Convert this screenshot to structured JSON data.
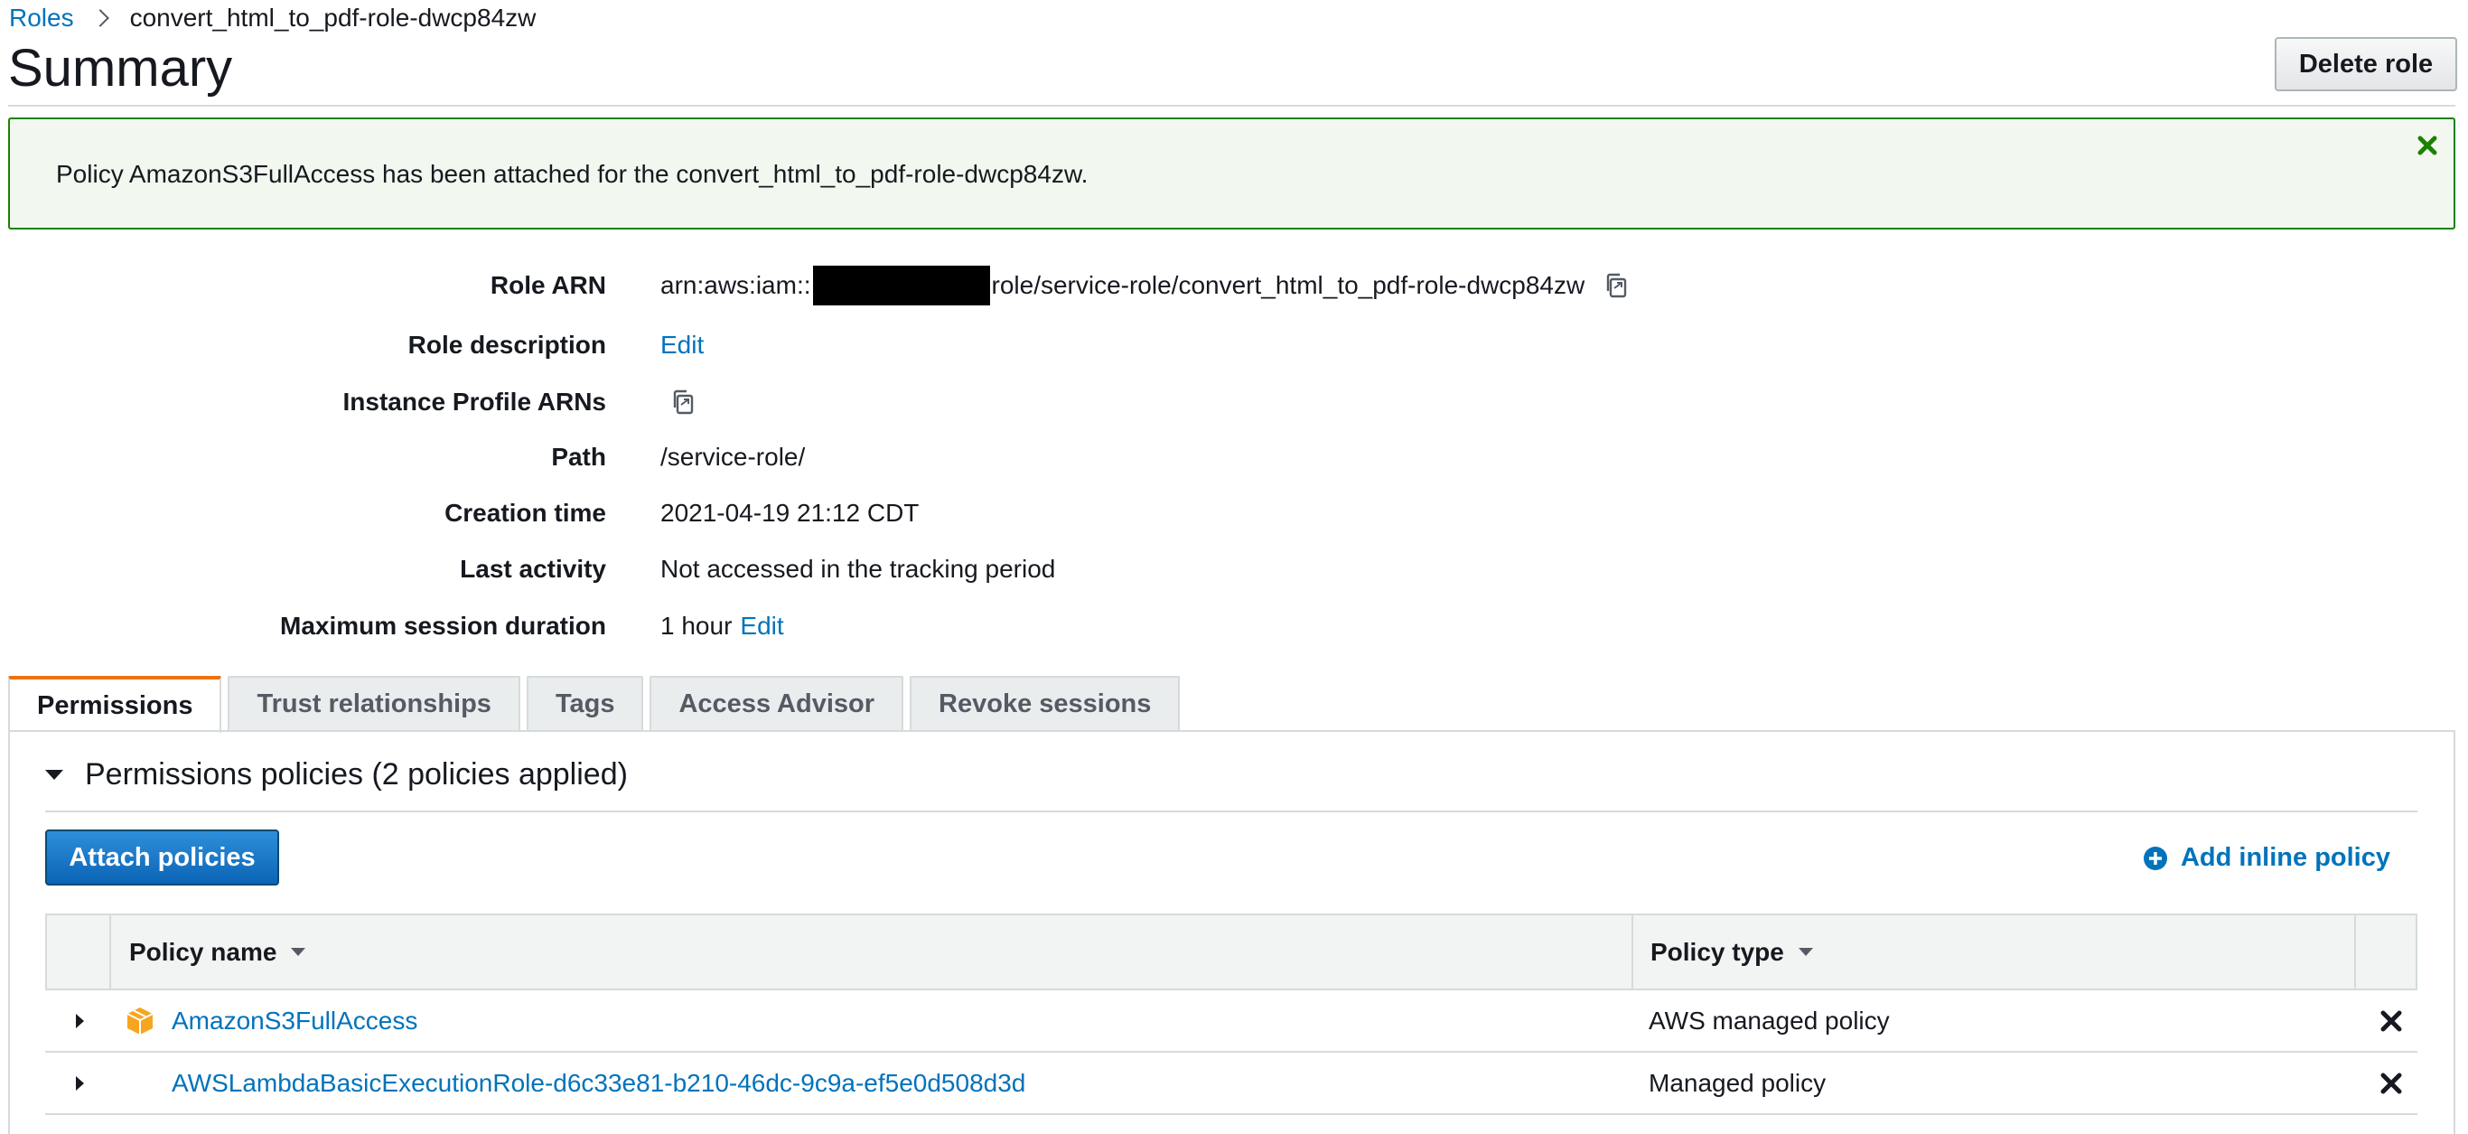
{
  "breadcrumb": {
    "roles_label": "Roles",
    "current": "convert_html_to_pdf-role-dwcp84zw"
  },
  "page_title": "Summary",
  "delete_role_label": "Delete role",
  "flash": {
    "message": "Policy AmazonS3FullAccess has been attached for the convert_html_to_pdf-role-dwcp84zw."
  },
  "details": {
    "role_arn": {
      "label": "Role ARN",
      "prefix": "arn:aws:iam::",
      "suffix": "role/service-role/convert_html_to_pdf-role-dwcp84zw"
    },
    "role_description": {
      "label": "Role description",
      "edit": "Edit"
    },
    "instance_profile": {
      "label": "Instance Profile ARNs"
    },
    "path": {
      "label": "Path",
      "value": "/service-role/"
    },
    "creation_time": {
      "label": "Creation time",
      "value": "2021-04-19 21:12 CDT"
    },
    "last_activity": {
      "label": "Last activity",
      "value": "Not accessed in the tracking period"
    },
    "max_session": {
      "label": "Maximum session duration",
      "value": "1 hour",
      "edit": "Edit"
    }
  },
  "tabs": [
    {
      "label": "Permissions",
      "active": true
    },
    {
      "label": "Trust relationships",
      "active": false
    },
    {
      "label": "Tags",
      "active": false
    },
    {
      "label": "Access Advisor",
      "active": false
    },
    {
      "label": "Revoke sessions",
      "active": false
    }
  ],
  "permissions": {
    "section_title": "Permissions policies (2 policies applied)",
    "attach_label": "Attach policies",
    "add_inline_label": "Add inline policy",
    "columns": {
      "policy_name": "Policy name",
      "policy_type": "Policy type"
    },
    "rows": [
      {
        "name": "AmazonS3FullAccess",
        "type": "AWS managed policy",
        "icon": "aws-managed-box-icon"
      },
      {
        "name": "AWSLambdaBasicExecutionRole-d6c33e81-b210-46dc-9c9a-ef5e0d508d3d",
        "type": "Managed policy",
        "icon": ""
      }
    ]
  },
  "colors": {
    "link": "#0073bb",
    "success_border": "#1d8102",
    "success_bg": "#f2f8f0",
    "tab_accent": "#ec7211",
    "primary": "#0b64b6"
  }
}
